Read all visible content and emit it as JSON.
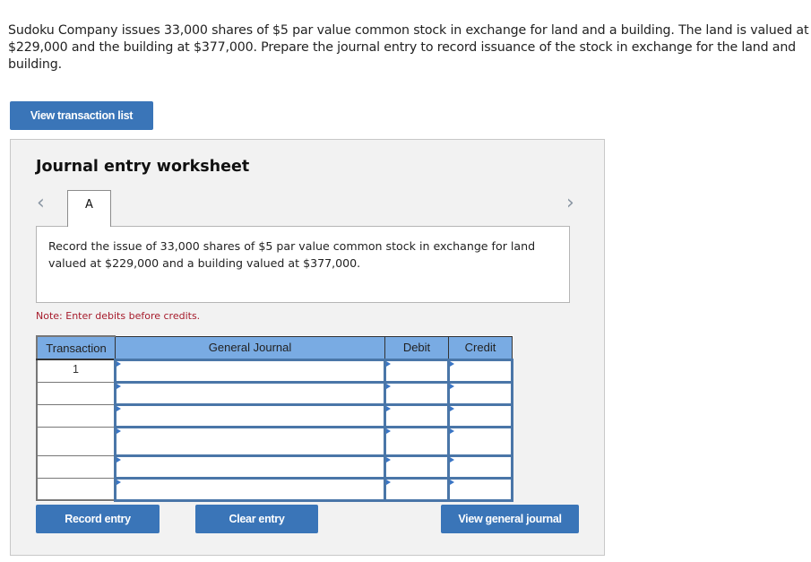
{
  "question": {
    "text": "Sudoku Company issues 33,000 shares of $5 par value common stock in exchange for land and a building. The land is valued at $229,000 and the building at $377,000. Prepare the journal entry to record issuance of the stock in exchange for the land and building."
  },
  "buttons": {
    "view_transaction_list": "View transaction list",
    "record_entry": "Record entry",
    "clear_entry": "Clear entry",
    "view_general_journal": "View general journal"
  },
  "worksheet": {
    "title": "Journal entry worksheet",
    "nav_prev_icon": "chevron-left-icon",
    "nav_next_icon": "chevron-right-icon",
    "tabs": [
      {
        "label": "A",
        "active": true
      }
    ],
    "description": "Record the issue of 33,000 shares of $5 par value common stock in exchange for land valued at $229,000 and a building valued at $377,000.",
    "note": "Note: Enter debits before credits."
  },
  "journal": {
    "columns": [
      "Transaction",
      "General Journal",
      "Debit",
      "Credit"
    ],
    "rows": [
      {
        "transaction": "1",
        "account": "",
        "debit": "",
        "credit": ""
      },
      {
        "transaction": "",
        "account": "",
        "debit": "",
        "credit": ""
      },
      {
        "transaction": "",
        "account": "",
        "debit": "",
        "credit": ""
      },
      {
        "transaction": "",
        "account": "",
        "debit": "",
        "credit": ""
      },
      {
        "transaction": "",
        "account": "",
        "debit": "",
        "credit": ""
      },
      {
        "transaction": "",
        "account": "",
        "debit": "",
        "credit": ""
      }
    ]
  },
  "colors": {
    "button_blue": "#3a75b8",
    "header_blue": "#79abe3",
    "input_border": "#4a76a8",
    "note_red": "#a61b2b"
  }
}
